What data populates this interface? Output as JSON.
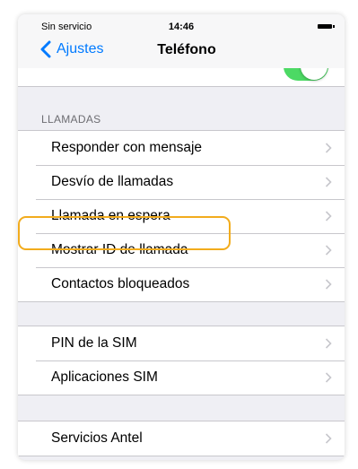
{
  "status_bar": {
    "carrier": "Sin servicio",
    "time": "14:46"
  },
  "nav": {
    "back_label": "Ajustes",
    "title": "Teléfono"
  },
  "section_calls": {
    "header": "LLAMADAS",
    "items": [
      {
        "label": "Responder con mensaje"
      },
      {
        "label": "Desvío de llamadas"
      },
      {
        "label": "Llamada en espera"
      },
      {
        "label": "Mostrar ID de llamada"
      },
      {
        "label": "Contactos bloqueados"
      }
    ]
  },
  "section_sim": {
    "items": [
      {
        "label": "PIN de la SIM"
      },
      {
        "label": "Aplicaciones SIM"
      }
    ]
  },
  "section_services": {
    "items": [
      {
        "label": "Servicios Antel"
      }
    ]
  },
  "colors": {
    "accent": "#007aff",
    "toggle_on": "#4cd964",
    "highlight": "#f2ac1d"
  },
  "icons": {
    "back": "chevron-left-icon",
    "disclosure": "chevron-right-icon"
  }
}
